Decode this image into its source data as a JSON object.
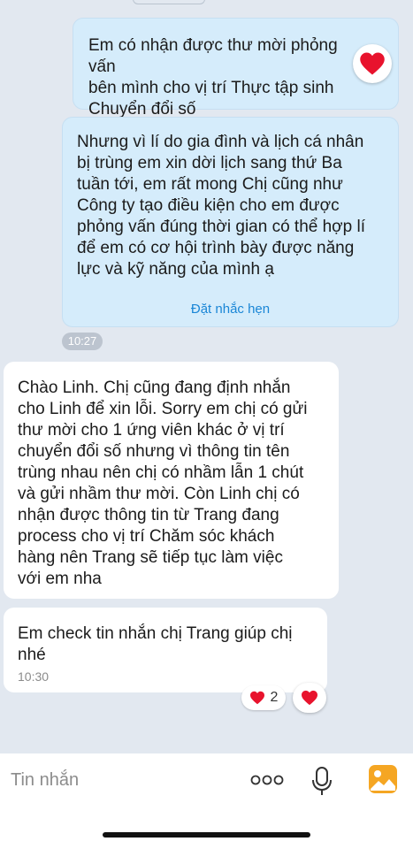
{
  "messages": [
    {
      "direction": "outgoing",
      "text": "Em có nhận được thư mời phỏng vấn\nbên mình cho vị trí Thực tập sinh\nChuyển đổi số",
      "reaction": "heart"
    },
    {
      "direction": "outgoing",
      "text": "Nhưng vì lí do gia đình và lịch cá nhân\nbị trùng em xin dời lịch sang thứ Ba\ntuần tới, em rất mong Chị cũng như\nCông ty tạo điều kiện cho em được\nphỏng vấn đúng thời gian có thể hợp lí\nđể em có cơ hội trình bày được năng\nlực và kỹ năng của mình ạ",
      "action_label": "Đặt nhắc hẹn",
      "time": "10:27"
    },
    {
      "direction": "incoming",
      "text": "Chào Linh. Chị cũng đang định nhắn\ncho Linh để xin lỗi. Sorry em chị có gửi\nthư mời cho 1 ứng viên khác ở vị trí\nchuyển đổi số nhưng vì thông tin tên\ntrùng nhau nên chị có nhầm lẫn 1 chút\nvà gửi nhầm thư mời. Còn Linh chị có\nnhận được thông tin từ Trang đang\nprocess cho vị trí Chăm sóc khách\nhàng nên Trang sẽ tiếp tục làm việc\nvới em nha"
    },
    {
      "direction": "incoming",
      "text": "Em check tin nhắn chị Trang giúp chị\nnhé",
      "time": "10:30",
      "reaction_count": "2",
      "reaction_icon": "heart-icon"
    }
  ],
  "input": {
    "placeholder": "Tin nhắn"
  },
  "icons": {
    "more": "more-dots-icon",
    "mic": "microphone-icon",
    "image": "image-picker-icon"
  },
  "colors": {
    "outgoing_bubble": "#d5ecfb",
    "incoming_bubble": "#ffffff",
    "chat_background": "#e2e8f0",
    "link": "#1a86d6",
    "heart": "#e8132d",
    "image_icon": "#f5a623"
  }
}
